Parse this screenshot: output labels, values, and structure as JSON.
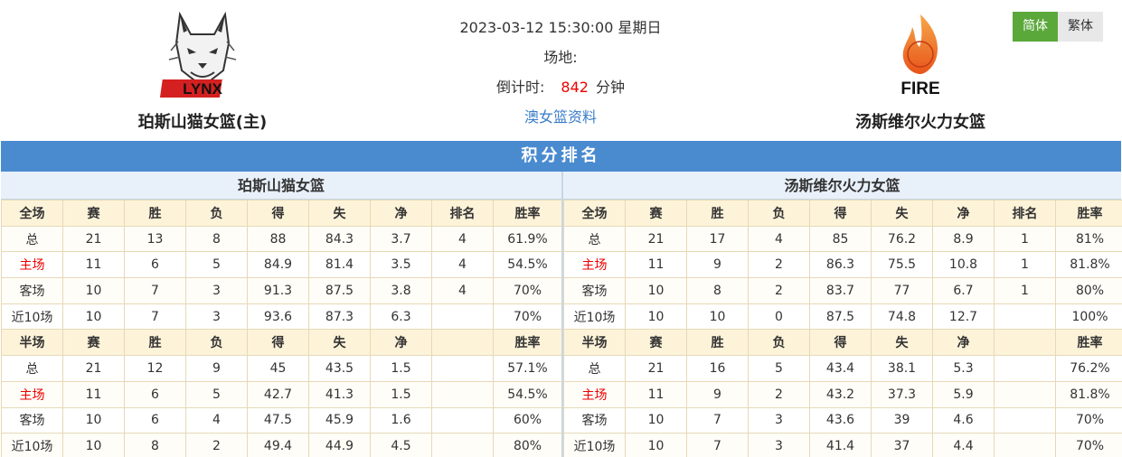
{
  "match": {
    "datetime": "2023-03-12 15:30:00 星期日",
    "venue_label": "场地:",
    "countdown_label": "倒计时:",
    "countdown_value": "842",
    "countdown_unit": "分钟",
    "league_link": "澳女篮资料"
  },
  "home_team": {
    "name": "珀斯山猫女篮(主)",
    "logo_text": "LYNX"
  },
  "away_team": {
    "name": "汤斯维尔火力女篮",
    "logo_text": "FIRE"
  },
  "lang": {
    "simplified": "简体",
    "traditional": "繁体"
  },
  "standings": {
    "title": "积分排名",
    "home": {
      "title": "珀斯山猫女篮",
      "full_header": [
        "全场",
        "赛",
        "胜",
        "负",
        "得",
        "失",
        "净",
        "排名",
        "胜率"
      ],
      "full_rows": [
        [
          "总",
          "21",
          "13",
          "8",
          "88",
          "84.3",
          "3.7",
          "4",
          "61.9%"
        ],
        [
          "主场",
          "11",
          "6",
          "5",
          "84.9",
          "81.4",
          "3.5",
          "4",
          "54.5%"
        ],
        [
          "客场",
          "10",
          "7",
          "3",
          "91.3",
          "87.5",
          "3.8",
          "4",
          "70%"
        ],
        [
          "近10场",
          "10",
          "7",
          "3",
          "93.6",
          "87.3",
          "6.3",
          "",
          "70%"
        ]
      ],
      "half_header": [
        "半场",
        "赛",
        "胜",
        "负",
        "得",
        "失",
        "净",
        "",
        "胜率"
      ],
      "half_rows": [
        [
          "总",
          "21",
          "12",
          "9",
          "45",
          "43.5",
          "1.5",
          "",
          "57.1%"
        ],
        [
          "主场",
          "11",
          "6",
          "5",
          "42.7",
          "41.3",
          "1.5",
          "",
          "54.5%"
        ],
        [
          "客场",
          "10",
          "6",
          "4",
          "47.5",
          "45.9",
          "1.6",
          "",
          "60%"
        ],
        [
          "近10场",
          "10",
          "8",
          "2",
          "49.4",
          "44.9",
          "4.5",
          "",
          "80%"
        ]
      ]
    },
    "away": {
      "title": "汤斯维尔火力女篮",
      "full_header": [
        "全场",
        "赛",
        "胜",
        "负",
        "得",
        "失",
        "净",
        "排名",
        "胜率"
      ],
      "full_rows": [
        [
          "总",
          "21",
          "17",
          "4",
          "85",
          "76.2",
          "8.9",
          "1",
          "81%"
        ],
        [
          "主场",
          "11",
          "9",
          "2",
          "86.3",
          "75.5",
          "10.8",
          "1",
          "81.8%"
        ],
        [
          "客场",
          "10",
          "8",
          "2",
          "83.7",
          "77",
          "6.7",
          "1",
          "80%"
        ],
        [
          "近10场",
          "10",
          "10",
          "0",
          "87.5",
          "74.8",
          "12.7",
          "",
          "100%"
        ]
      ],
      "half_header": [
        "半场",
        "赛",
        "胜",
        "负",
        "得",
        "失",
        "净",
        "",
        "胜率"
      ],
      "half_rows": [
        [
          "总",
          "21",
          "16",
          "5",
          "43.4",
          "38.1",
          "5.3",
          "",
          "76.2%"
        ],
        [
          "主场",
          "11",
          "9",
          "2",
          "43.2",
          "37.3",
          "5.9",
          "",
          "81.8%"
        ],
        [
          "客场",
          "10",
          "7",
          "3",
          "43.6",
          "39",
          "4.6",
          "",
          "70%"
        ],
        [
          "近10场",
          "10",
          "7",
          "3",
          "41.4",
          "37",
          "4.4",
          "",
          "70%"
        ]
      ]
    }
  },
  "colors": {
    "accent_blue": "#4a8bd0",
    "highlight_red": "#e00000",
    "lang_active": "#5aa83a"
  }
}
